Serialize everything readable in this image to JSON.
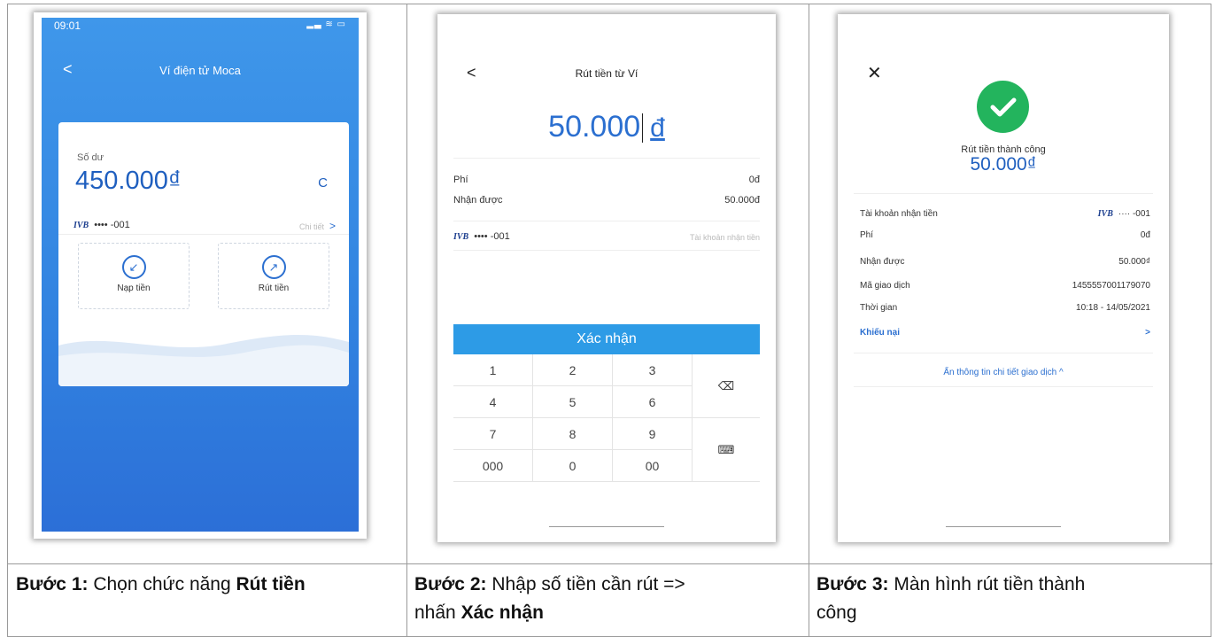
{
  "step1": {
    "status_time": "09:01",
    "status_icons": "▂▃ ≋ ▭",
    "back": "<",
    "title": "Ví điện tử Moca",
    "balance_label": "Số dư",
    "balance": "450.000₫",
    "refresh": "C",
    "bank_logo": "IVB",
    "bank_mask": "•••• -001",
    "detail": "Chi tiết",
    "detail_chevron": ">",
    "topup_label": "Nạp tiền",
    "withdraw_label": "Rút tiền"
  },
  "step2": {
    "back": "<",
    "title": "Rút tiền từ Ví",
    "amount": "50.000",
    "currency": "đ",
    "fee_label": "Phí",
    "fee_value": "0đ",
    "received_label": "Nhận được",
    "received_value": "50.000đ",
    "bank_logo": "IVB",
    "bank_mask": "•••• -001",
    "bank_hint": "Tài khoản nhận tiền",
    "confirm": "Xác nhận",
    "keys": [
      "1",
      "2",
      "3",
      "4",
      "5",
      "6",
      "7",
      "8",
      "9",
      "000",
      "0",
      "00"
    ],
    "backspace": "⌫",
    "keyboard_icon": "⌨"
  },
  "step3": {
    "close": "✕",
    "check": "✓",
    "title": "Rút tiền thành công",
    "amount": "50.000₫",
    "account_label": "Tài khoản nhận tiền",
    "bank_logo": "IVB",
    "account_mask": "···· -001",
    "fee_label": "Phí",
    "fee_value": "0đ",
    "received_label": "Nhận được",
    "received_value": "50.000₫",
    "txn_label": "Mã giao dịch",
    "txn_value": "1455557001179070",
    "time_label": "Thời gian",
    "time_value": "10:18 - 14/05/2021",
    "complain": "Khiếu nại",
    "complain_chevron": ">",
    "hide_info": "Ẩn thông tin chi tiết giao dịch ^"
  },
  "captions": {
    "c1_bold": "Bước 1:",
    "c1_text": " Chọn chức năng ",
    "c1_bold2": "Rút tiền",
    "c2_bold": "Bước 2:",
    "c2_text": " Nhập số tiền cần rút =>",
    "c2_text2": "nhấn ",
    "c2_bold2": "Xác nhận",
    "c3_bold": "Bước 3:",
    "c3_text": " Màn hình rút tiền thành",
    "c3_text2": "công"
  },
  "colors": {
    "primary_blue": "#2b6fd0",
    "confirm_blue": "#2d9be6",
    "success_green": "#23b45d",
    "screen_gradient_top": "#3f97ea"
  }
}
